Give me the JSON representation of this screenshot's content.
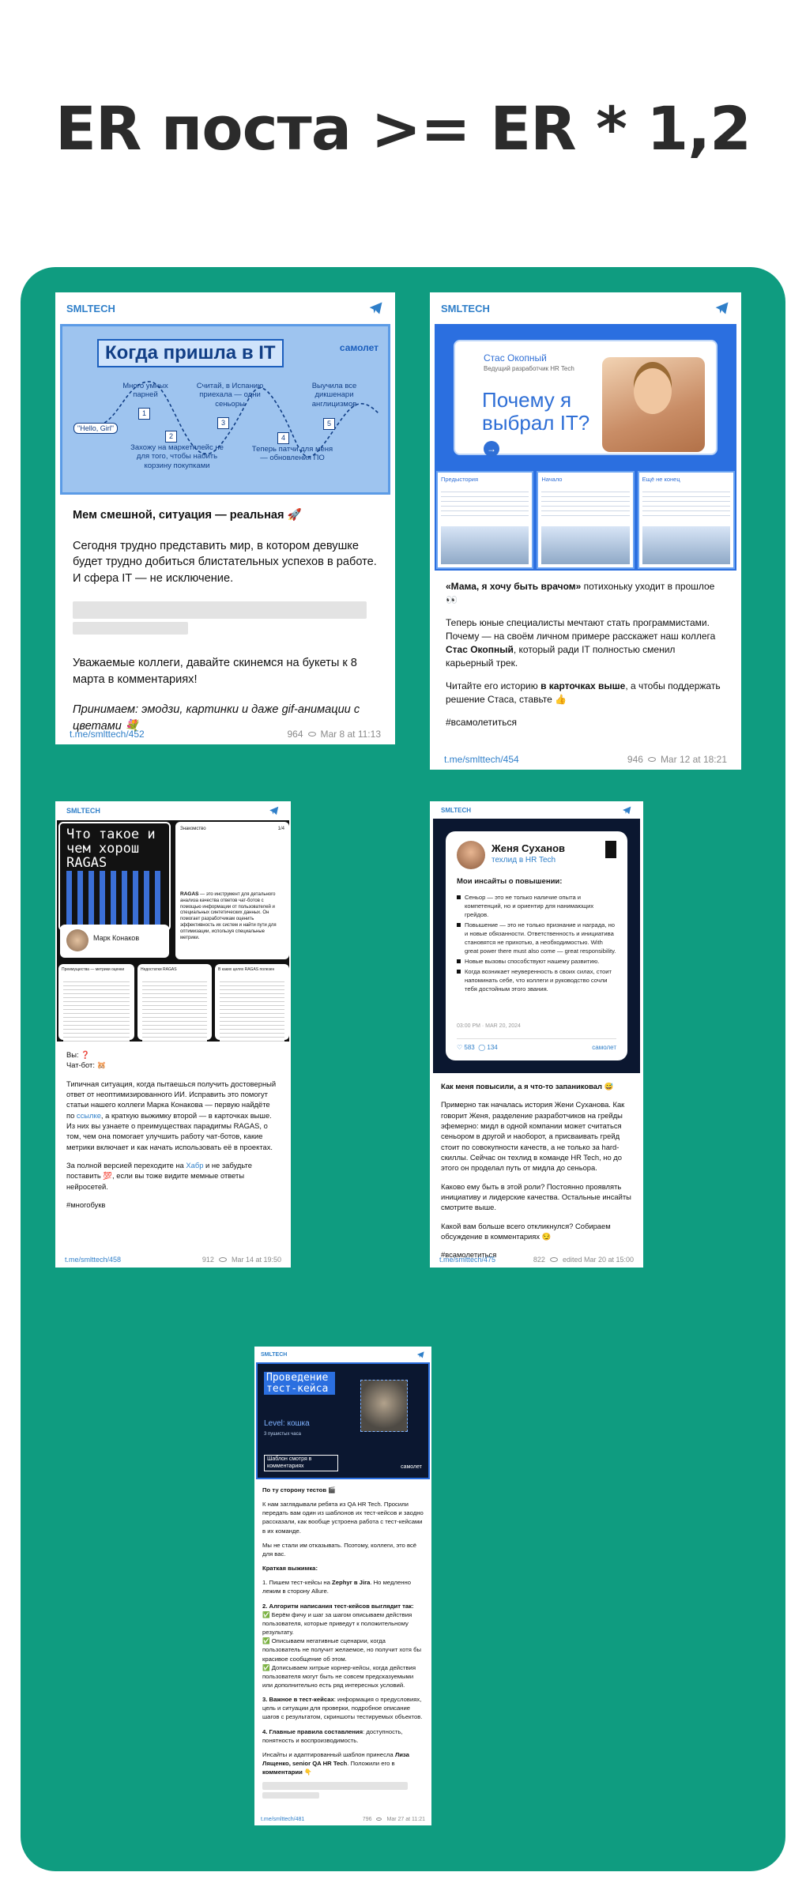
{
  "headline": "ER поста >= ER * 1,2",
  "channel": "SMLTECH",
  "icons": {
    "telegram": "telegram-paper-plane-icon",
    "views": "eye-icon"
  },
  "colors": {
    "panel": "#0f9c80",
    "link": "#2f7fc9"
  },
  "post1": {
    "image": {
      "title": "Когда пришла в IT",
      "brand": "самолет",
      "start": "\"Hello, Girl\"",
      "steps": [
        {
          "n": "1",
          "label": "Много умных парней"
        },
        {
          "n": "2",
          "label": "Захожу на маркетплейс не для того, чтобы набить корзину покупками"
        },
        {
          "n": "3",
          "label": "Считай, в Испанию приехала — одни сеньоры"
        },
        {
          "n": "4",
          "label": "Теперь патчи для меня — обновления ПО"
        },
        {
          "n": "5",
          "label": "Выучила все дикшенари англицизмов"
        }
      ]
    },
    "bold_line": "Мем смешной, ситуация — реальная 🚀",
    "p1": "Сегодня трудно представить мир, в котором девушке будет трудно добиться блистательных успехов в работе. И сфера IT — не исключение.",
    "p2": "Уважаемые коллеги, давайте скинемся на букеты к 8 марта в комментариях!",
    "p3": "Принимаем: эмодзи, картинки и даже gif-анимации с цветами 💐",
    "link": "t.me/smlttech/452",
    "views": "964",
    "date": "Mar 8 at 11:13"
  },
  "post2": {
    "image": {
      "name": "Стас Окопный",
      "role": "Ведущий разработчик HR Tech",
      "big": "Почему я выбрал IT?",
      "cards": [
        "Предыстория",
        "Начало",
        "Ещё не конец"
      ]
    },
    "p1_bold": "«Мама, я хочу быть врачом»",
    "p1_rest": " потихоньку уходит в прошлое 👀",
    "p2_a": "Теперь юные специалисты мечтают стать программистами. Почему — на своём личном примере расскажет наш коллега ",
    "p2_bold": "Стас Окопный",
    "p2_b": ", который ради IT полностью сменил карьерный трек.",
    "p3_a": "Читайте его историю ",
    "p3_bold": "в карточках выше",
    "p3_b": ", а чтобы поддержать решение Стаса, ставьте 👍",
    "tag": "#всамолетиться",
    "link": "t.me/smlttech/454",
    "views": "946",
    "date": "Mar 12 at 18:21"
  },
  "post3": {
    "image": {
      "title": "Что такое и чем хорош RAGAS",
      "person": "Марк Конаков",
      "intro_label": "Знакомство",
      "page": "1/4",
      "intro_bold": "RAGAS",
      "intro_text": " — это инструмент для детального анализа качества ответов чат-ботов с помощью информации от пользователей и специальных синтетических данных. Он помогает разработчикам оценить эффективность их систем и найти пути для оптимизации, используя специальные метрики.",
      "small_titles": [
        "Преимущества — метрики оценки",
        "Недостатки RAGAS",
        "В каких целях RAGAS полезен"
      ]
    },
    "q1": "Вы: ❓",
    "q2": "Чат-бот: 🐹",
    "p1_a": "Типичная ситуация, когда пытаешься получить достоверный ответ от неоптимизированного ИИ. Исправить это помогут статьи нашего коллеги Марка Конакова — первую найдёте по ",
    "p1_link": "ссылке",
    "p1_b": ", а краткую выжимку второй — в карточках выше. Из них вы узнаете о преимуществах парадигмы RAGAS, о том, чем она помогает улучшить работу чат-ботов, какие метрики включает и как начать использовать её в проектах.",
    "p2_a": "За полной версией переходите на ",
    "p2_link": "Хабр",
    "p2_b": " и не забудьте поставить 💯, если вы тоже видите мемные ответы нейросетей.",
    "tag": "#многобукв",
    "link": "t.me/smlttech/458",
    "views": "912",
    "date": "Mar 14 at 19:50"
  },
  "post4": {
    "image": {
      "name": "Женя Суханов",
      "role": "техлид в HR Tech",
      "heading": "Мои инсайты о повышении:",
      "items": [
        "Сеньор — это не только наличие опыта и компетенций, но и ориентир для нанимающих грейдов.",
        "Повышение — это не только признание и награда, но и новые обязанности. Ответственность и инициатива становятся не прихотью, а необходимостью. With great power there must also come — great responsibility.",
        "Новые вызовы способствуют нашему развитию.",
        "Когда возникает неуверенность в своих силах, стоит напоминать себе, что коллеги и руководство сочли тебя достойным этого звания."
      ],
      "date": "03:00 PM · MAR 20, 2024",
      "likes": "583",
      "comments": "134",
      "brand": "самолет"
    },
    "bold_line": "Как меня повысили, а я что-то запаниковал 😅",
    "p1": "Примерно так началась история Жени Суханова. Как говорит Женя, разделение разработчиков на грейды эфемерно: мидл в одной компании может считаться сеньором в другой и наоборот, а присваивать грейд стоит по совокупности качеств, а не только за hard-скиллы. Сейчас он техлид в команде HR Tech, но до этого он проделал путь от мидла до сеньора.",
    "p2": "Каково ему быть в этой роли? Постоянно проявлять инициативу и лидерские качества. Остальные инсайты смотрите выше.",
    "p3": "Какой вам больше всего откликнулся? Собираем обсуждение в комментариях 😏",
    "tag": "#всамолетиться",
    "link": "t.me/smlttech/475",
    "views": "822",
    "date": "edited  Mar 20 at 15:00"
  },
  "post5": {
    "image": {
      "title": "Проведение тест-кейса",
      "level": "Level: кошка",
      "sub": "3 пушистых часа",
      "footer": "Шаблон смотря в комментариях",
      "brand": "самолет"
    },
    "bold_line": "По ту сторону тестов 🎬",
    "p1": "К нам заглядывали ребята из QA HR Tech. Просили передать вам один из шаблонов их тест-кейсов и заодно рассказали, как вообще устроена работа с тест-кейсами в их команде.",
    "p2": "Мы не стали им отказывать. Поэтому, коллеги, это всё для вас.",
    "summary": "Краткая выжимка:",
    "s1_a": "1. Пишем тест-кейсы на ",
    "s1_bold": "Zephyr в Jira",
    "s1_b": ". Но медленно лежим в сторону Allure.",
    "s2_head": "2. Алгоритм написания тест-кейсов выглядит так:",
    "s2_l1": "✅ Берём фичу и шаг за шагом описываем действия пользователя, которые приведут к положительному результату.",
    "s2_l2": "✅ Описываем негативные сценарии, когда пользователь не получит желаемое, но получит хотя бы красивое сообщение об этом.",
    "s2_l3": "✅ Дописываем хитрые корнер-кейсы, когда действия пользователя могут быть не совсем предсказуемыми или дополнительно есть ряд интересных условий.",
    "s3_bold": "3. Важное в тест-кейсах",
    "s3_rest": ": информация о предусловиях, цель и ситуации для проверки, подробное описание шагов с результатом, скриншоты тестируемых объектов.",
    "s4_bold": "4. Главные правила составления",
    "s4_rest": ": доступность, понятность и воспроизводимость.",
    "p3_a": "Инсайты и адаптированный шаблон принесла ",
    "p3_bold": "Лиза Лященко, senior QA HR Tech",
    "p3_b": ". Положили его в ",
    "p3_bold2": "комментарии",
    "p3_c": " 👇",
    "link": "t.me/smlttech/481",
    "views": "796",
    "date": "Mar 27 at 11:21"
  }
}
